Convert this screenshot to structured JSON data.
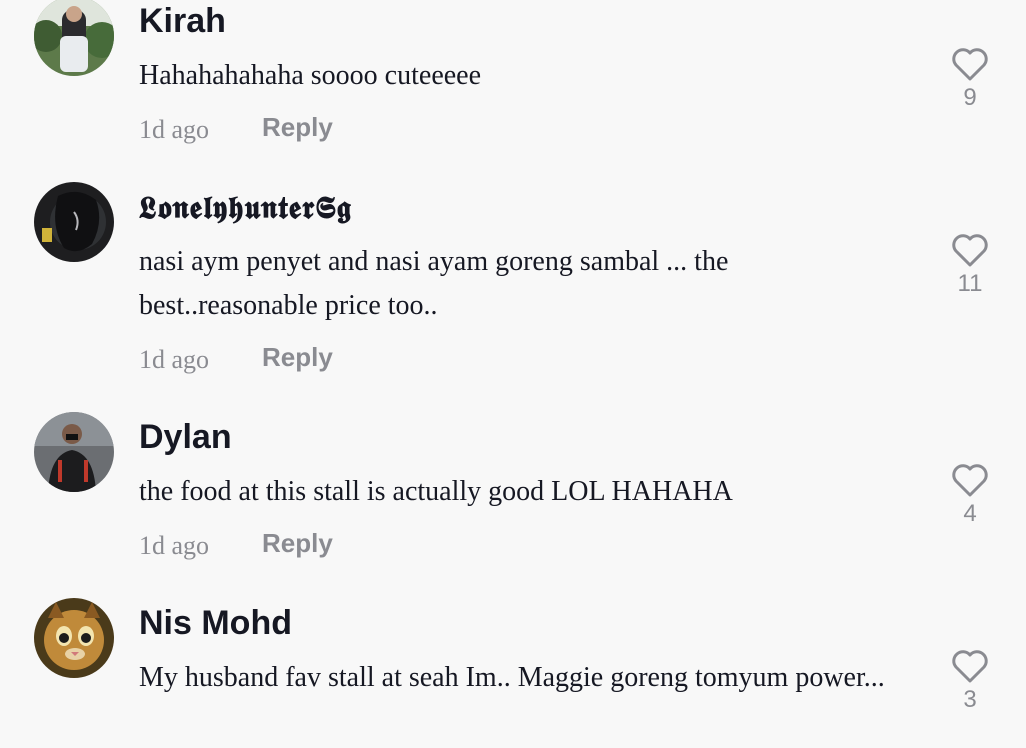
{
  "comments": [
    {
      "username": "Kirah",
      "text": "Hahahahahaha soooo cuteeeee",
      "time": "1d ago",
      "reply": "Reply",
      "likes": "9"
    },
    {
      "username": "𝕷𝖔𝖓𝖊𝖑𝖞𝖍𝖚𝖓𝖙𝖊𝖗𝕾𝖌",
      "text": "nasi aym penyet and nasi ayam goreng sambal ... the best..reasonable price too..",
      "time": "1d ago",
      "reply": "Reply",
      "likes": "11"
    },
    {
      "username": "Dylan",
      "text": "the food at this stall is actually good LOL HAHAHA",
      "time": "1d ago",
      "reply": "Reply",
      "likes": "4"
    },
    {
      "username": "Nis Mohd",
      "text": "My husband fav stall at seah Im.. Maggie goreng tomyum power...",
      "likes": "3"
    }
  ],
  "colors": {
    "background": "#f8f8f8",
    "text": "#161823",
    "muted": "#8a8b91"
  },
  "icons": {
    "like": "heart-outline-icon"
  }
}
